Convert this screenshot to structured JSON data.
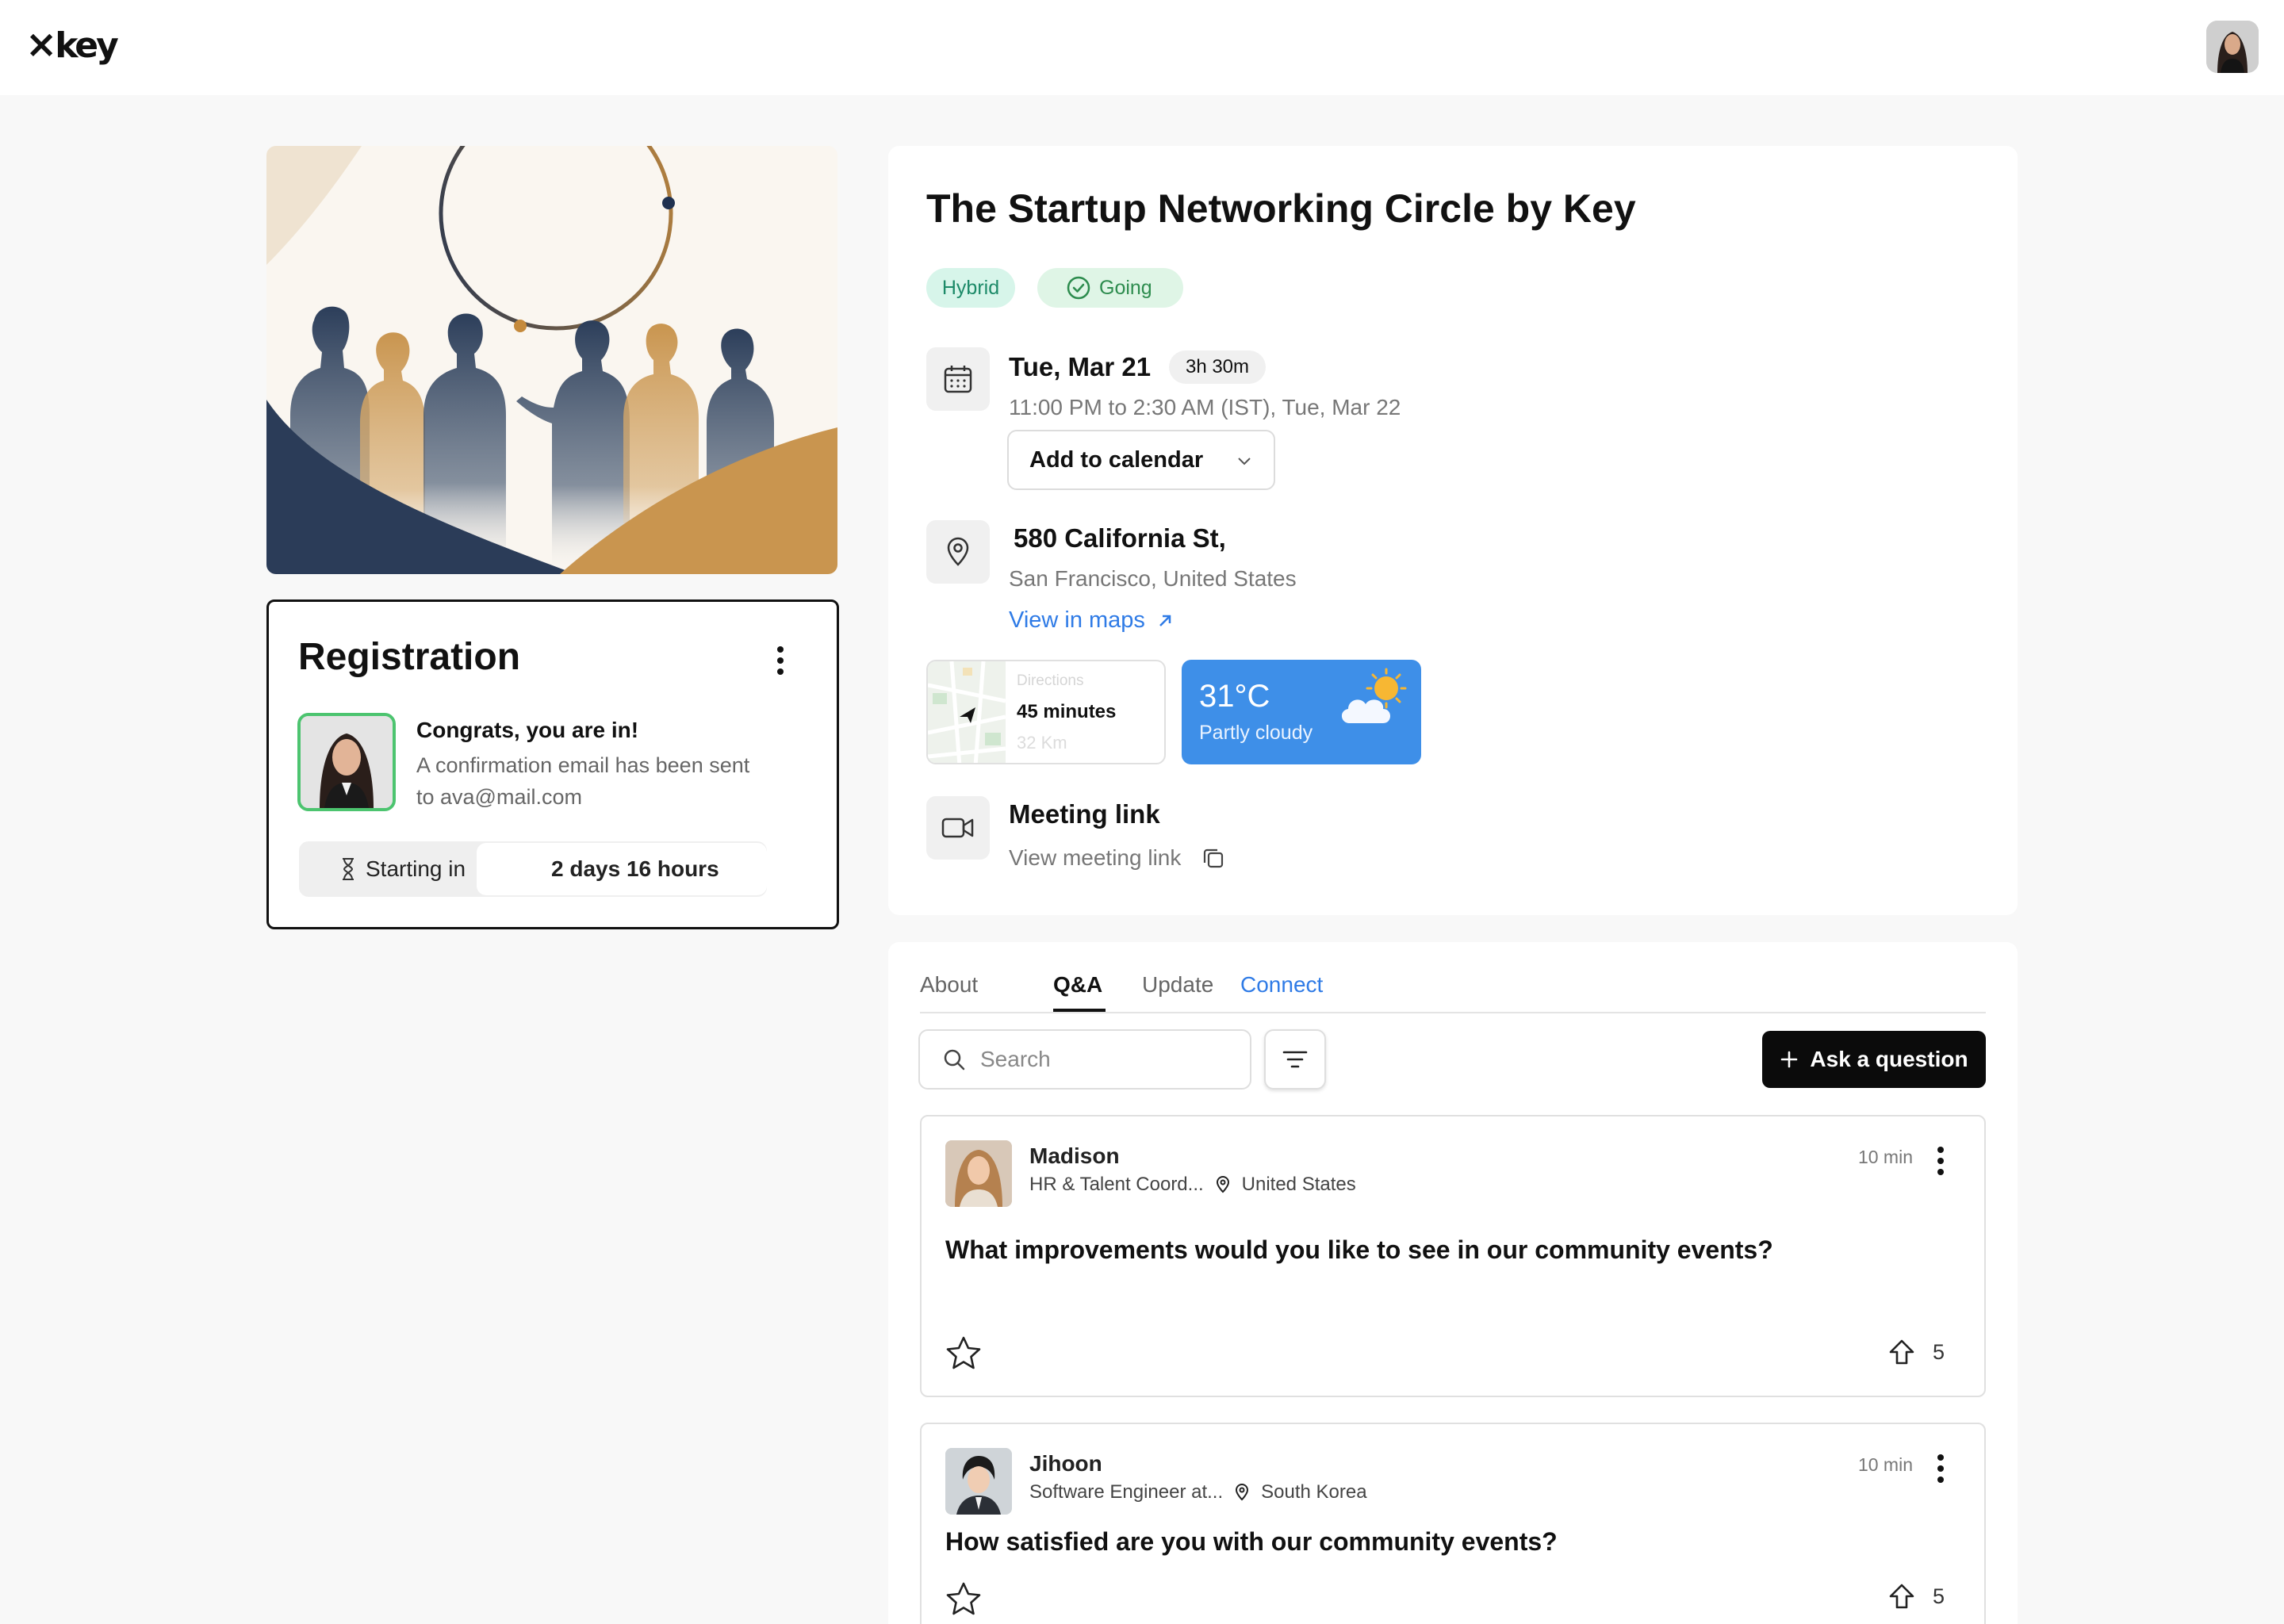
{
  "header": {
    "logo": "key"
  },
  "registration": {
    "title": "Registration",
    "congrats": "Congrats, you are in!",
    "message": "A confirmation email has been sent to ava@mail.com",
    "starting_label": "Starting in",
    "countdown": "2 days 16 hours"
  },
  "event": {
    "title": "The Startup Networking Circle by Key",
    "badges": {
      "type": "Hybrid",
      "status": "Going"
    },
    "date": "Tue, Mar 21",
    "duration": "3h 30m",
    "time_range": "11:00 PM to 2:30 AM (IST), Tue, Mar 22",
    "calendar_button": "Add to calendar",
    "address": "580 California St,",
    "city": "San Francisco, United States",
    "maps_link": "View in maps",
    "directions": {
      "label": "Directions",
      "time": "45 minutes",
      "distance": "32 Km"
    },
    "weather": {
      "temp": "31°C",
      "desc": "Partly cloudy"
    },
    "meeting": {
      "title": "Meeting link",
      "link_text": "View meeting link"
    }
  },
  "tabs": [
    "About",
    "Q&A",
    "Update",
    "Connect"
  ],
  "active_tab": "Q&A",
  "search": {
    "placeholder": "Search"
  },
  "ask_button": "Ask a question",
  "questions": [
    {
      "name": "Madison",
      "role": "HR & Talent Coord...",
      "location": "United States",
      "time": "10 min",
      "question": "What improvements would you like to see in our community events?",
      "votes": "5"
    },
    {
      "name": "Jihoon",
      "role": "Software Engineer at...",
      "location": "South Korea",
      "time": "10 min",
      "question": "How satisfied are you with our community events?",
      "votes": "5"
    }
  ],
  "colors": {
    "accent_blue": "#2f7be6",
    "going_green": "#2d8c4e",
    "weather_blue": "#3e8fe8",
    "ask_button": "#0b0b0b"
  }
}
